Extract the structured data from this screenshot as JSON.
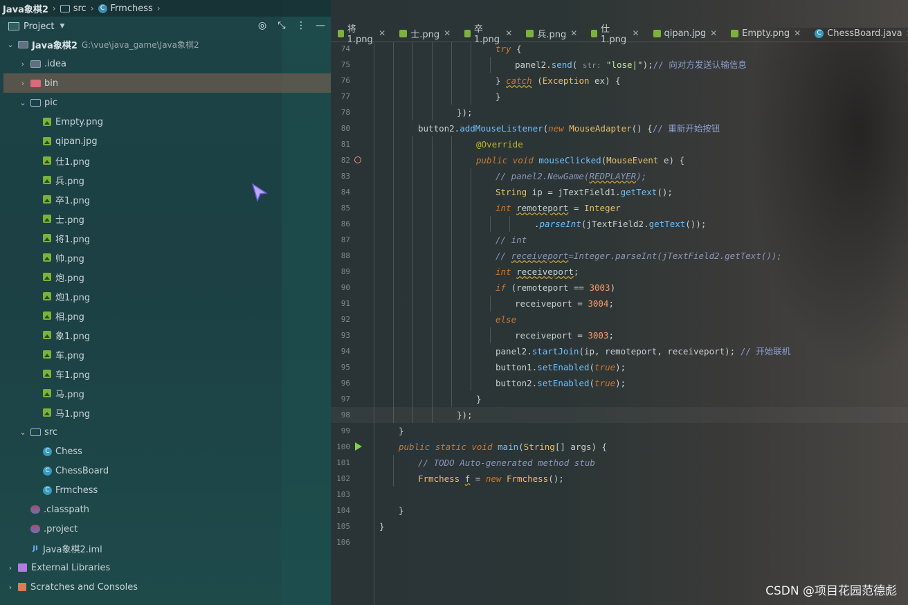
{
  "breadcrumb": [
    "Java象棋2",
    "src",
    "Frmchess"
  ],
  "project_panel": {
    "title": "Project",
    "tree": [
      {
        "level": 0,
        "arrow": "down",
        "icon": "folder",
        "label": "Java象棋2",
        "hint": "G:\\vue\\java_game\\Java象棋2",
        "bold": true
      },
      {
        "level": 1,
        "arrow": "right",
        "icon": "folder",
        "label": ".idea"
      },
      {
        "level": 1,
        "arrow": "right",
        "icon": "folder-red",
        "label": "bin",
        "selected": true
      },
      {
        "level": 1,
        "arrow": "down",
        "icon": "folder-outline",
        "label": "pic"
      },
      {
        "level": 2,
        "icon": "image",
        "label": "Empty.png"
      },
      {
        "level": 2,
        "icon": "image",
        "label": "qipan.jpg"
      },
      {
        "level": 2,
        "icon": "image",
        "label": "仕1.png"
      },
      {
        "level": 2,
        "icon": "image",
        "label": "兵.png"
      },
      {
        "level": 2,
        "icon": "image",
        "label": "卒1.png"
      },
      {
        "level": 2,
        "icon": "image",
        "label": "士.png"
      },
      {
        "level": 2,
        "icon": "image",
        "label": "将1.png"
      },
      {
        "level": 2,
        "icon": "image",
        "label": "帅.png"
      },
      {
        "level": 2,
        "icon": "image",
        "label": "炮.png"
      },
      {
        "level": 2,
        "icon": "image",
        "label": "炮1.png"
      },
      {
        "level": 2,
        "icon": "image",
        "label": "相.png"
      },
      {
        "level": 2,
        "icon": "image",
        "label": "象1.png"
      },
      {
        "level": 2,
        "icon": "image",
        "label": "车.png"
      },
      {
        "level": 2,
        "icon": "image",
        "label": "车1.png"
      },
      {
        "level": 2,
        "icon": "image",
        "label": "马.png"
      },
      {
        "level": 2,
        "icon": "image",
        "label": "马1.png"
      },
      {
        "level": 1,
        "arrow": "down",
        "icon": "folder-outline",
        "label": "src"
      },
      {
        "level": 2,
        "icon": "class",
        "label": "Chess"
      },
      {
        "level": 2,
        "icon": "class",
        "label": "ChessBoard"
      },
      {
        "level": 2,
        "icon": "class",
        "label": "Frmchess"
      },
      {
        "level": 1,
        "icon": "config",
        "label": ".classpath"
      },
      {
        "level": 1,
        "icon": "config",
        "label": ".project"
      },
      {
        "level": 1,
        "icon": "iml",
        "label": "Java象棋2.iml"
      },
      {
        "level": 0,
        "arrow": "right",
        "icon": "library",
        "label": "External Libraries"
      },
      {
        "level": 0,
        "arrow": "right",
        "icon": "scratch",
        "label": "Scratches and Consoles"
      }
    ]
  },
  "tabs": [
    {
      "icon": "image",
      "label": "将1.png"
    },
    {
      "icon": "image",
      "label": "士.png"
    },
    {
      "icon": "image",
      "label": "卒1.png"
    },
    {
      "icon": "image",
      "label": "兵.png"
    },
    {
      "icon": "image",
      "label": "仕1.png"
    },
    {
      "icon": "image",
      "label": "qipan.jpg"
    },
    {
      "icon": "image",
      "label": "Empty.png"
    },
    {
      "icon": "class",
      "label": "ChessBoard.java"
    }
  ],
  "code_lines": [
    {
      "n": "74",
      "indent": 6,
      "html": "<span class='kw'>try</span> {"
    },
    {
      "n": "75",
      "indent": 7,
      "html": "panel2.<span class='fn'>send</span>( <span class='hint'>str:</span> <span class='str'>\"lose|\"</span>);<span class='cmz'>// 向对方发送认输信息</span>"
    },
    {
      "n": "76",
      "indent": 6,
      "html": "} <span class='kw sq'>catch</span> (<span class='ty'>Exception</span> ex) {"
    },
    {
      "n": "77",
      "indent": 6,
      "html": "}"
    },
    {
      "n": "78",
      "indent": 4,
      "html": "});"
    },
    {
      "n": "80",
      "indent": 2,
      "html": "button2.<span class='fn'>addMouseListener</span>(<span class='kw'>new</span> <span class='ty'>MouseAdapter</span>() {<span class='cmz'>// 重新开始按钮</span>"
    },
    {
      "n": "81",
      "indent": 5,
      "html": "<span class='ann'>@Override</span>"
    },
    {
      "n": "82",
      "indent": 5,
      "html": "<span class='kw'>public</span> <span class='kw'>void</span> <span class='fn'>mouseClicked</span>(<span class='ty'>MouseEvent</span> e) {",
      "gutter": "override"
    },
    {
      "n": "83",
      "indent": 6,
      "html": "<span class='cm'>// panel2.NewGame(<span class='sq'>REDPLAYER</span>);</span>"
    },
    {
      "n": "84",
      "indent": 6,
      "html": "<span class='ty'>String</span> ip = jTextField1.<span class='fn'>getText</span>();"
    },
    {
      "n": "85",
      "indent": 6,
      "html": "<span class='kw'>int</span> <span class='sq'>remoteport</span> = <span class='ty'>Integer</span>"
    },
    {
      "n": "86",
      "indent": 8,
      "html": ".<span class='fn' style='font-style:italic'>parseInt</span>(jTextField2.<span class='fn'>getText</span>());"
    },
    {
      "n": "87",
      "indent": 6,
      "html": "<span class='cm'>// int</span>"
    },
    {
      "n": "88",
      "indent": 6,
      "html": "<span class='cm'>// <span class='sq'>receiveport</span>=Integer.parseInt(jTextField2.getText());</span>"
    },
    {
      "n": "89",
      "indent": 6,
      "html": "<span class='kw'>int</span> <span class='sq'>receiveport</span>;"
    },
    {
      "n": "90",
      "indent": 6,
      "html": "<span class='kw'>if</span> (remoteport == <span class='num'>3003</span>)"
    },
    {
      "n": "91",
      "indent": 7,
      "html": "receiveport = <span class='num'>3004</span>;"
    },
    {
      "n": "92",
      "indent": 6,
      "html": "<span class='kw'>else</span>"
    },
    {
      "n": "93",
      "indent": 7,
      "html": "receiveport = <span class='num'>3003</span>;"
    },
    {
      "n": "94",
      "indent": 6,
      "html": "panel2.<span class='fn'>startJoin</span>(ip, remoteport, receiveport); <span class='cmz'>// 开始联机</span>"
    },
    {
      "n": "95",
      "indent": 6,
      "html": "button1.<span class='fn'>setEnabled</span>(<span class='kw'>true</span>);"
    },
    {
      "n": "96",
      "indent": 6,
      "html": "button2.<span class='fn'>setEnabled</span>(<span class='kw'>true</span>);"
    },
    {
      "n": "97",
      "indent": 5,
      "html": "}"
    },
    {
      "n": "98",
      "indent": 4,
      "html": "});",
      "highlight": true
    },
    {
      "n": "99",
      "indent": 1,
      "html": "}"
    },
    {
      "n": "100",
      "indent": 1,
      "html": "<span class='kw'>public</span> <span class='kw'>static</span> <span class='kw'>void</span> <span class='fn'>main</span>(<span class='ty'>String</span>[] args) {",
      "gutter": "run"
    },
    {
      "n": "101",
      "indent": 2,
      "html": "<span class='cm'>// TODO Auto-generated method stub</span>"
    },
    {
      "n": "102",
      "indent": 2,
      "html": "<span class='ty'>Frmchess</span> <span class='sq'>f</span> = <span class='kw'>new</span> <span class='ty'>Frmchess</span>();"
    },
    {
      "n": "103",
      "indent": 0,
      "html": ""
    },
    {
      "n": "104",
      "indent": 1,
      "html": "}"
    },
    {
      "n": "105",
      "indent": 0,
      "html": "}"
    },
    {
      "n": "106",
      "indent": 0,
      "html": ""
    }
  ],
  "watermark": "CSDN @项目花园范德彪"
}
